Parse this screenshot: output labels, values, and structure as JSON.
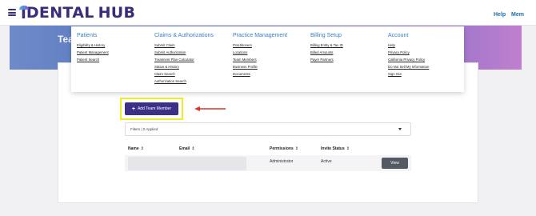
{
  "logo": {
    "text_i": "i",
    "text_dental": "DENTAL",
    "text_hub": "HUB"
  },
  "topnav": {
    "help": "Help",
    "members": "Mem"
  },
  "hero": {
    "title": "Tea"
  },
  "menu": {
    "columns": [
      {
        "heading": "Patients",
        "items": [
          "Eligibility & History",
          "Patient Management",
          "Patient Search"
        ]
      },
      {
        "heading": "Claims & Authorizations",
        "items": [
          "Submit Claim",
          "Submit Authorization",
          "Treatment Plan Calculator",
          "Status & History",
          "Claim Search",
          "Authorization Search"
        ]
      },
      {
        "heading": "Practice Management",
        "items": [
          "Practitioners",
          "Locations",
          "Team Members",
          "Business Profile",
          "Documents"
        ]
      },
      {
        "heading": "Billing Setup",
        "items": [
          "Billing Entity & Tax ID",
          "Billed Amounts",
          "Payer Partners"
        ]
      },
      {
        "heading": "Account",
        "items": [
          "Help",
          "Privacy Policy",
          "California Privacy Policy",
          "Do Not Sell My Information",
          "Sign Out"
        ]
      }
    ]
  },
  "actions": {
    "add_team_member": "Add Team Member",
    "add_icon": "+"
  },
  "filters": {
    "label": "Filters | 0 Applied"
  },
  "table": {
    "headers": {
      "name": "Name",
      "email": "Email",
      "permissions": "Permissions",
      "invite_status": "Invite Status",
      "sort_icon": "⇕"
    },
    "rows": [
      {
        "permissions": "Administrator",
        "invite_status": "Active",
        "action": "View"
      }
    ]
  },
  "colors": {
    "brand": "#3a2d7e",
    "accent": "#3a7fc0",
    "highlight": "#f0ea2e",
    "arrow": "#d9342b",
    "button": "#3b2f86"
  }
}
